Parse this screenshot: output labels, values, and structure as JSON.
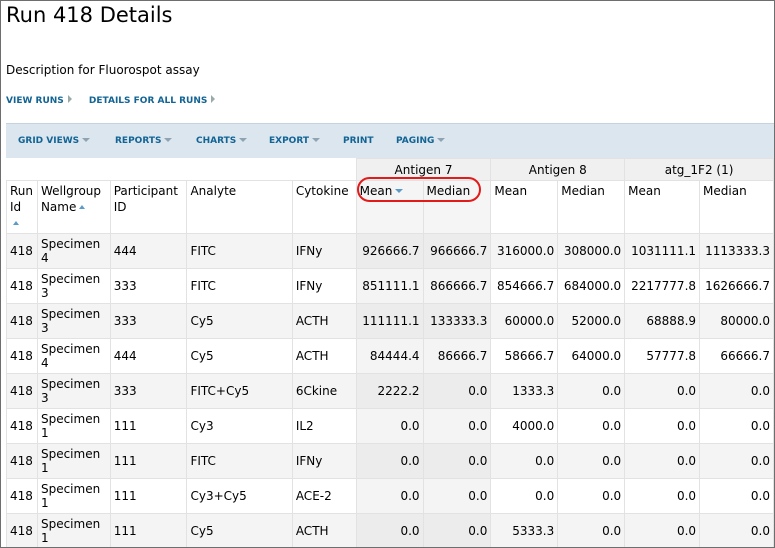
{
  "page": {
    "title": "Run 418 Details",
    "description": "Description for Fluorospot assay",
    "nav_links": [
      {
        "label": "VIEW RUNS"
      },
      {
        "label": "DETAILS FOR ALL RUNS"
      }
    ]
  },
  "toolbar": {
    "buttons": [
      {
        "label": "GRID VIEWS",
        "menu": true
      },
      {
        "label": "REPORTS",
        "menu": true
      },
      {
        "label": "CHARTS",
        "menu": true
      },
      {
        "label": "EXPORT",
        "menu": true
      },
      {
        "label": "PRINT",
        "menu": false
      },
      {
        "label": "PAGING",
        "menu": true
      }
    ]
  },
  "grid": {
    "group_headers": [
      "Antigen 7",
      "Antigen 8",
      "atg_1F2 (1)"
    ],
    "columns": {
      "run_id": "Run Id",
      "wellgroup": "Wellgroup Name",
      "participant": "Participant ID",
      "analyte": "Analyte",
      "cytokine": "Cytokine",
      "mean": "Mean",
      "median": "Median"
    },
    "rows": [
      {
        "run": "418",
        "wellgroup": "Specimen 4",
        "participant": "444",
        "analyte": "FITC",
        "cytokine": "IFNy",
        "a7_mean": "926666.7",
        "a7_median": "966666.7",
        "a8_mean": "316000.0",
        "a8_median": "308000.0",
        "atg_mean": "1031111.1",
        "atg_median": "1113333.3"
      },
      {
        "run": "418",
        "wellgroup": "Specimen 3",
        "participant": "333",
        "analyte": "FITC",
        "cytokine": "IFNy",
        "a7_mean": "851111.1",
        "a7_median": "866666.7",
        "a8_mean": "854666.7",
        "a8_median": "684000.0",
        "atg_mean": "2217777.8",
        "atg_median": "1626666.7"
      },
      {
        "run": "418",
        "wellgroup": "Specimen 3",
        "participant": "333",
        "analyte": "Cy5",
        "cytokine": "ACTH",
        "a7_mean": "111111.1",
        "a7_median": "133333.3",
        "a8_mean": "60000.0",
        "a8_median": "52000.0",
        "atg_mean": "68888.9",
        "atg_median": "80000.0"
      },
      {
        "run": "418",
        "wellgroup": "Specimen 4",
        "participant": "444",
        "analyte": "Cy5",
        "cytokine": "ACTH",
        "a7_mean": "84444.4",
        "a7_median": "86666.7",
        "a8_mean": "58666.7",
        "a8_median": "64000.0",
        "atg_mean": "57777.8",
        "atg_median": "66666.7"
      },
      {
        "run": "418",
        "wellgroup": "Specimen 3",
        "participant": "333",
        "analyte": "FITC+Cy5",
        "cytokine": "6Ckine",
        "a7_mean": "2222.2",
        "a7_median": "0.0",
        "a8_mean": "1333.3",
        "a8_median": "0.0",
        "atg_mean": "0.0",
        "atg_median": "0.0"
      },
      {
        "run": "418",
        "wellgroup": "Specimen 1",
        "participant": "111",
        "analyte": "Cy3",
        "cytokine": "IL2",
        "a7_mean": "0.0",
        "a7_median": "0.0",
        "a8_mean": "4000.0",
        "a8_median": "0.0",
        "atg_mean": "0.0",
        "atg_median": "0.0"
      },
      {
        "run": "418",
        "wellgroup": "Specimen 1",
        "participant": "111",
        "analyte": "FITC",
        "cytokine": "IFNy",
        "a7_mean": "0.0",
        "a7_median": "0.0",
        "a8_mean": "0.0",
        "a8_median": "0.0",
        "atg_mean": "0.0",
        "atg_median": "0.0"
      },
      {
        "run": "418",
        "wellgroup": "Specimen 1",
        "participant": "111",
        "analyte": "Cy3+Cy5",
        "cytokine": "ACE-2",
        "a7_mean": "0.0",
        "a7_median": "0.0",
        "a8_mean": "0.0",
        "a8_median": "0.0",
        "atg_mean": "0.0",
        "atg_median": "0.0"
      },
      {
        "run": "418",
        "wellgroup": "Specimen 1",
        "participant": "111",
        "analyte": "Cy5",
        "cytokine": "ACTH",
        "a7_mean": "0.0",
        "a7_median": "0.0",
        "a8_mean": "5333.3",
        "a8_median": "0.0",
        "atg_mean": "0.0",
        "atg_median": "0.0"
      }
    ]
  },
  "colors": {
    "link": "#126495",
    "toolbar_bg": "#dbe6ef",
    "highlight": "#e21a1a",
    "sort_indicator": "#5b9bc9"
  },
  "icons": {
    "sort_ascending": "sort-ascending-icon",
    "sort_descending": "sort-descending-icon",
    "menu_caret": "caret-down-icon",
    "nav_arrow": "arrow-right-icon"
  }
}
